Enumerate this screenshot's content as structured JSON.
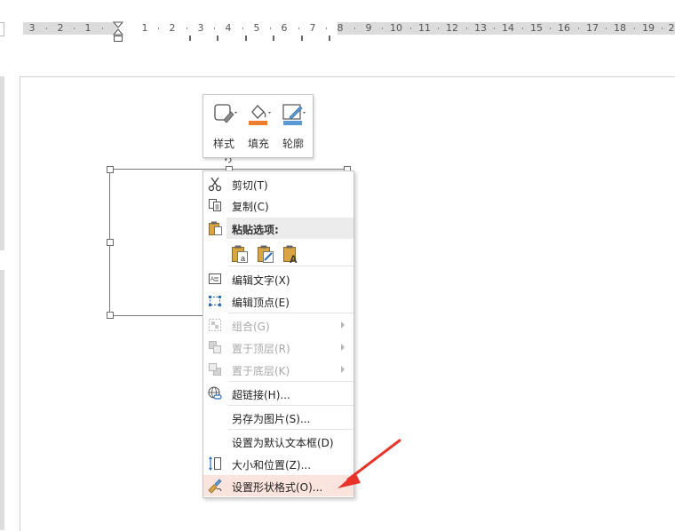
{
  "ruler": {
    "numbers_left": [
      "3",
      "2",
      "1"
    ],
    "numbers_right": [
      "1",
      "2",
      "3",
      "4",
      "5",
      "6",
      "7",
      "8",
      "9",
      "10",
      "11",
      "12",
      "13",
      "14",
      "15",
      "16",
      "17",
      "18",
      "19",
      "2"
    ]
  },
  "mini_toolbar": {
    "style_label": "样式",
    "fill_label": "填充",
    "outline_label": "轮廓"
  },
  "context_menu": {
    "cut": "剪切(T)",
    "copy": "复制(C)",
    "paste_options": "粘贴选项:",
    "edit_text": "编辑文字(X)",
    "edit_points": "编辑顶点(E)",
    "group": "组合(G)",
    "bring_to_front": "置于顶层(R)",
    "send_to_back": "置于底层(K)",
    "hyperlink": "超链接(H)...",
    "save_as_picture": "另存为图片(S)...",
    "set_default_textbox": "设置为默认文本框(D)",
    "size_position": "大小和位置(Z)...",
    "format_shape": "设置形状格式(O)..."
  },
  "colors": {
    "fill_accent": "#ed7d31",
    "outline_accent": "#5b9bd5",
    "highlight": "#fbe3de",
    "arrow": "#e8332a"
  }
}
